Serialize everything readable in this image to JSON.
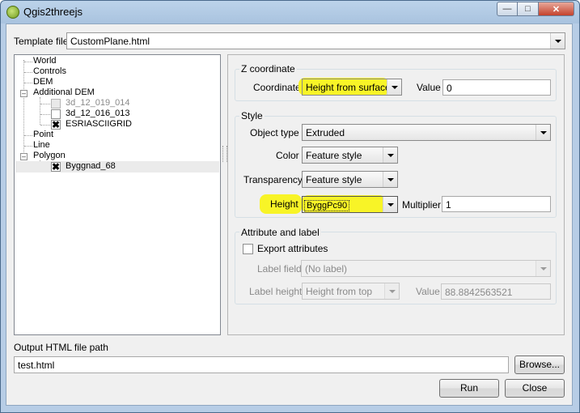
{
  "window": {
    "title": "Qgis2threejs"
  },
  "template": {
    "label": "Template file",
    "value": "CustomPlane.html"
  },
  "tree": {
    "items": [
      "World",
      "Controls",
      "DEM",
      "Additional DEM",
      "3d_12_019_014",
      "3d_12_016_013",
      "ESRIASCIIGRID",
      "Point",
      "Line",
      "Polygon",
      "Byggnad_68"
    ]
  },
  "z_coordinate": {
    "title": "Z coordinate",
    "coordinate_label": "Coordinate",
    "coordinate_value": "Height from surface",
    "value_label": "Value",
    "value": "0"
  },
  "style": {
    "title": "Style",
    "object_type_label": "Object type",
    "object_type_value": "Extruded",
    "color_label": "Color",
    "color_value": "Feature style",
    "transparency_label": "Transparency",
    "transparency_value": "Feature style",
    "height_label": "Height",
    "height_value": "ByggPc90",
    "multiplier_label": "Multiplier",
    "multiplier_value": "1"
  },
  "attribute": {
    "title": "Attribute and label",
    "export_label": "Export attributes",
    "label_field_label": "Label field",
    "label_field_value": "(No label)",
    "label_height_label": "Label height",
    "label_height_value": "Height from top",
    "value_label": "Value",
    "value": "88.8842563521"
  },
  "output": {
    "label": "Output HTML file path",
    "value": "test.html",
    "browse": "Browse..."
  },
  "buttons": {
    "run": "Run",
    "close": "Close"
  },
  "colors": {
    "highlight": "#f8f427"
  }
}
